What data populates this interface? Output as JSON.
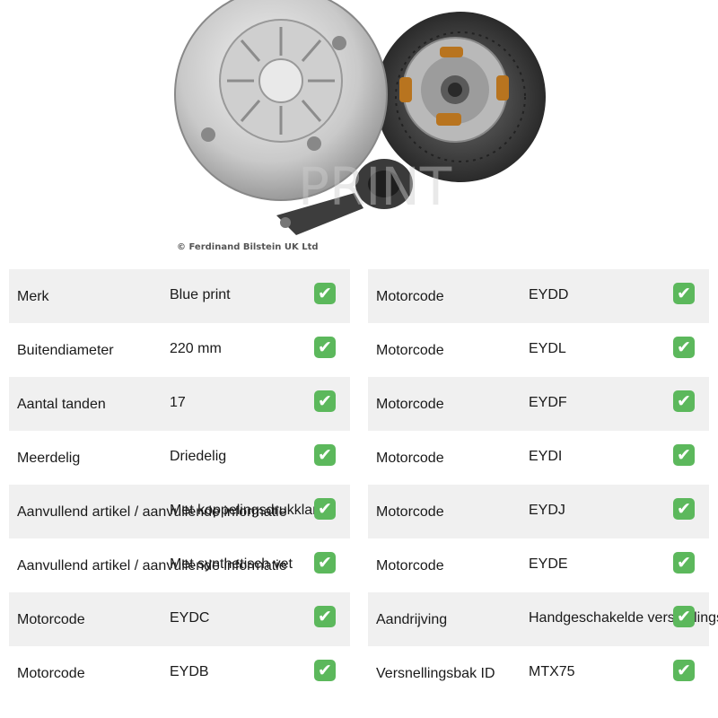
{
  "image": {
    "alt": "Koppelingsset",
    "copyright": "© Ferdinand Bilstein UK Ltd",
    "watermark": "PRINT"
  },
  "check_icon": "check-mark-button",
  "left_rows": [
    {
      "label": "Merk",
      "value": "Blue print"
    },
    {
      "label": "Buitendiameter",
      "value": "220 mm"
    },
    {
      "label": "Aantal tanden",
      "value": "17"
    },
    {
      "label": "Meerdelig",
      "value": "Driedelig"
    },
    {
      "label": "Aanvullend artikel / aanvullende informatie",
      "value": "Met koppelingsdrukklamp"
    },
    {
      "label": "Aanvullend artikel / aanvullende informatie",
      "value": "Met synthetisch vet"
    },
    {
      "label": "Motorcode",
      "value": "EYDC"
    },
    {
      "label": "Motorcode",
      "value": "EYDB"
    }
  ],
  "right_rows": [
    {
      "label": "Motorcode",
      "value": "EYDD"
    },
    {
      "label": "Motorcode",
      "value": "EYDL"
    },
    {
      "label": "Motorcode",
      "value": "EYDF"
    },
    {
      "label": "Motorcode",
      "value": "EYDI"
    },
    {
      "label": "Motorcode",
      "value": "EYDJ"
    },
    {
      "label": "Motorcode",
      "value": "EYDE"
    },
    {
      "label": "Aandrijving",
      "value": "Handgeschakelde versnellingsbak"
    },
    {
      "label": "Versnellingsbak ID",
      "value": "MTX75"
    }
  ]
}
